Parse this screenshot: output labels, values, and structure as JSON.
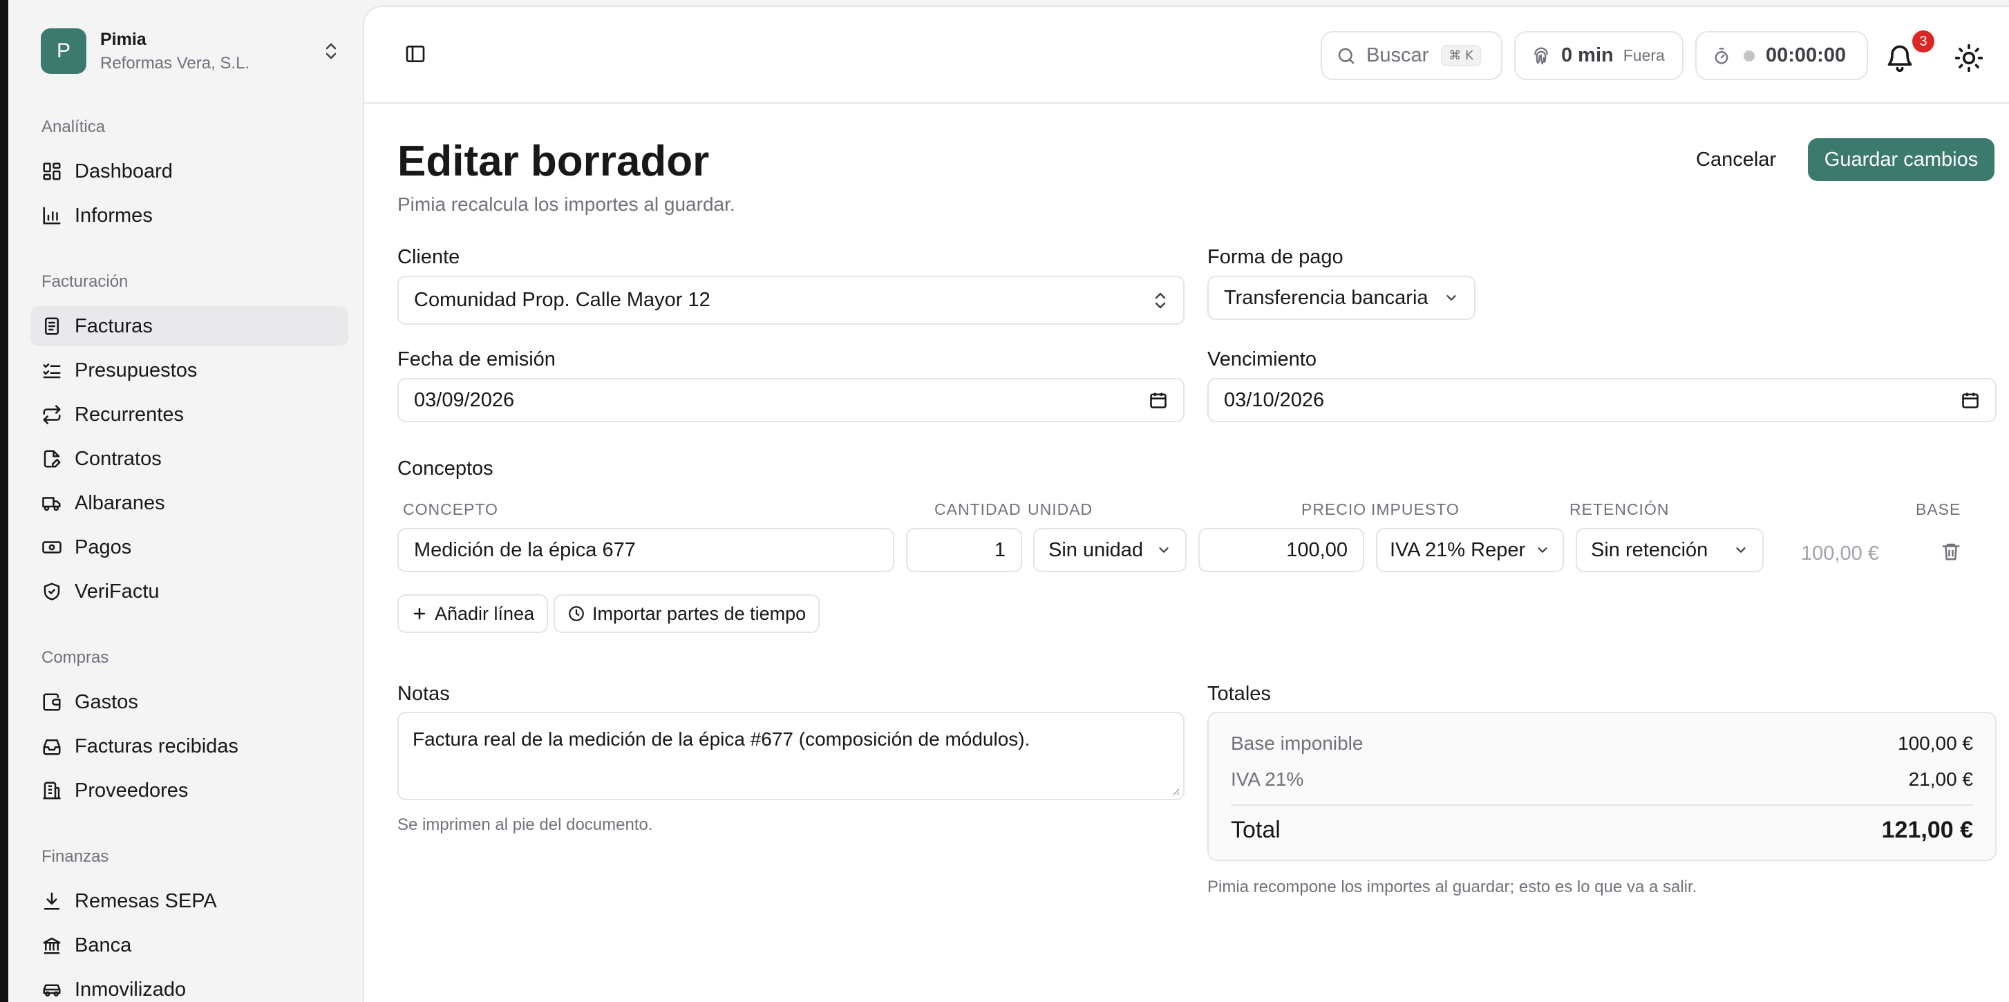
{
  "org": {
    "initial": "P",
    "name": "Pimia",
    "company": "Reformas Vera, S.L."
  },
  "sidebar": {
    "sections": [
      {
        "label": "Analítica",
        "items": [
          {
            "label": "Dashboard",
            "icon": "dashboard-icon"
          },
          {
            "label": "Informes",
            "icon": "bar-chart-icon"
          }
        ]
      },
      {
        "label": "Facturación",
        "items": [
          {
            "label": "Facturas",
            "icon": "invoice-icon",
            "active": true
          },
          {
            "label": "Presupuestos",
            "icon": "checklist-icon"
          },
          {
            "label": "Recurrentes",
            "icon": "repeat-icon"
          },
          {
            "label": "Contratos",
            "icon": "file-edit-icon"
          },
          {
            "label": "Albaranes",
            "icon": "truck-icon"
          },
          {
            "label": "Pagos",
            "icon": "banknote-icon"
          },
          {
            "label": "VeriFactu",
            "icon": "shield-check-icon"
          }
        ]
      },
      {
        "label": "Compras",
        "items": [
          {
            "label": "Gastos",
            "icon": "wallet-icon"
          },
          {
            "label": "Facturas recibidas",
            "icon": "inbox-icon"
          },
          {
            "label": "Proveedores",
            "icon": "building-icon"
          }
        ]
      },
      {
        "label": "Finanzas",
        "items": [
          {
            "label": "Remesas SEPA",
            "icon": "download-icon"
          },
          {
            "label": "Banca",
            "icon": "bank-icon"
          },
          {
            "label": "Inmovilizado",
            "icon": "car-icon"
          }
        ]
      }
    ]
  },
  "topbar": {
    "search": {
      "label": "Buscar",
      "shortcut": "⌘ K"
    },
    "time_tracked": {
      "value": "0 min",
      "status": "Fuera"
    },
    "timer": {
      "value": "00:00:00"
    },
    "notifications_count": "3"
  },
  "page": {
    "title": "Editar borrador",
    "subtitle": "Pimia recalcula los importes al guardar.",
    "cancel_label": "Cancelar",
    "save_label": "Guardar cambios"
  },
  "form": {
    "client_label": "Cliente",
    "client_value": "Comunidad Prop. Calle Mayor 12",
    "payment_label": "Forma de pago",
    "payment_value": "Transferencia bancaria",
    "issue_date_label": "Fecha de emisión",
    "issue_date_value": "03/09/2026",
    "due_label": "Vencimiento",
    "due_value": "03/10/2026"
  },
  "concepts": {
    "title": "Conceptos",
    "columns": {
      "concept": "CONCEPTO",
      "quantity": "CANTIDAD",
      "unit": "UNIDAD",
      "price": "PRECIO",
      "tax": "IMPUESTO",
      "withholding": "RETENCIÓN",
      "base": "BASE"
    },
    "lines": [
      {
        "concept": "Medición de la épica 677",
        "quantity": "1",
        "unit": "Sin unidad",
        "price": "100,00",
        "tax": "IVA 21% Reper",
        "withholding": "Sin retención",
        "base": "100,00 €"
      }
    ],
    "add_line_label": "Añadir línea",
    "import_label": "Importar partes de tiempo"
  },
  "notes": {
    "label": "Notas",
    "value": "Factura real de la medición de la épica #677 (composición de módulos).",
    "hint": "Se imprimen al pie del documento."
  },
  "totals": {
    "label": "Totales",
    "base_label": "Base imponible",
    "base_value": "100,00 €",
    "tax_label": "IVA 21%",
    "tax_value": "21,00 €",
    "total_label": "Total",
    "total_value": "121,00 €",
    "hint": "Pimia recompone los importes al guardar; esto es lo que va a salir."
  },
  "colors": {
    "accent": "#3d7a6e",
    "badge": "#dc2626"
  }
}
